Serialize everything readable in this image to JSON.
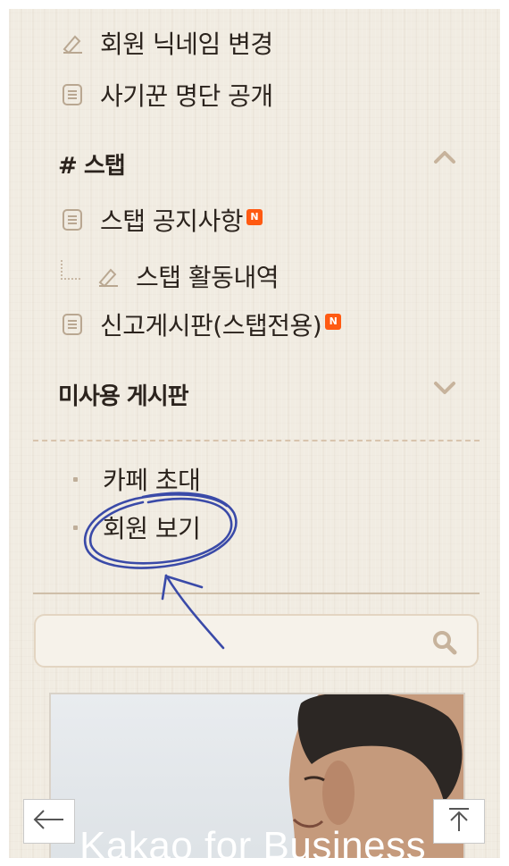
{
  "menu": {
    "top_items": [
      {
        "label": "회원 닉네임 변경",
        "icon": "pencil-icon"
      },
      {
        "label": "사기꾼 명단 공개",
        "icon": "board-icon"
      }
    ],
    "staff_section": {
      "title": "# 스탭",
      "collapse_icon": "chevron-up-icon",
      "items": [
        {
          "label": "스탭 공지사항",
          "icon": "board-icon",
          "badge": "N"
        },
        {
          "label": "스탭 활동내역",
          "icon": "pencil-icon",
          "indented": true
        },
        {
          "label": "신고게시판(스탭전용)",
          "icon": "board-icon",
          "badge": "N"
        }
      ]
    },
    "unused_section": {
      "title": "미사용 게시판",
      "expand_icon": "chevron-down-icon"
    },
    "links": [
      {
        "label": "카페 초대"
      },
      {
        "label": "회원 보기",
        "highlighted": true
      }
    ]
  },
  "search": {
    "placeholder": "",
    "value": "",
    "icon": "search-icon"
  },
  "banner": {
    "text": "Kakao for Business"
  },
  "nav": {
    "back_icon": "arrow-left-icon",
    "top_icon": "arrow-up-to-top-icon"
  },
  "annotation": {
    "color": "#3a4aa8",
    "shape": "hand-drawn circle with arrow"
  },
  "colors": {
    "background": "#f1ece2",
    "badge": "#ff5a12",
    "icon": "#b9a791",
    "divider": "#d8c4ad"
  }
}
